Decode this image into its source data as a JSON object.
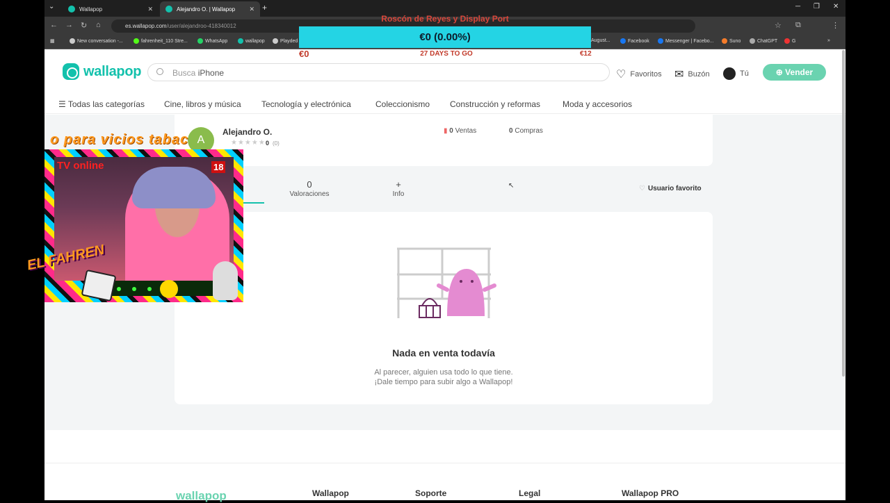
{
  "browser": {
    "tabs": [
      {
        "label": "Wallapop"
      },
      {
        "label": "Alejandro O. | Wallapop"
      }
    ],
    "url_host": "es.wallapop.com",
    "url_path": "/user/alejandroo-418340012",
    "bookmarks": [
      "New conversation -...",
      "fahrenheit_110 Stre...",
      "WhatsApp",
      "wallapop",
      "Playded",
      "August...",
      "Facebook",
      "Messenger | Facebo...",
      "Suno",
      "ChatGPT",
      "G"
    ]
  },
  "stream": {
    "title": "Roscón de Reyes y Display Port",
    "progress_label": "€0 (0.00%)",
    "progress_fraction": 0.0,
    "current": "€0",
    "days_to_go": "27 DAYS TO GO",
    "goal": "€12",
    "cam_top_text": "o para vicios tabac",
    "tv_online": "TV online",
    "age_badge": "18",
    "brand": "EL FAHREN"
  },
  "header": {
    "logo": "wallapop",
    "search_prefix": "Busca",
    "search_term": "iPhone",
    "favoritos": "Favoritos",
    "buzon": "Buzón",
    "tu": "Tú",
    "sell": "Vender"
  },
  "categories": [
    "Todas las categorías",
    "Cine, libros y música",
    "Tecnología y electrónica",
    "Coleccionismo",
    "Construcción y reformas",
    "Moda y accesorios"
  ],
  "profile": {
    "avatar_letter": "A",
    "name": "Alejandro O.",
    "rating": "0",
    "rating_count": "(0)",
    "ventas_num": "0",
    "ventas_label": "Ventas",
    "compras_num": "0",
    "compras_label": "Compras"
  },
  "tabs": {
    "valoraciones_num": "0",
    "valoraciones": "Valoraciones",
    "info_symbol": "+",
    "info": "Info",
    "usuario_favorito": "Usuario favorito"
  },
  "empty": {
    "title": "Nada en venta todavía",
    "description": "Al parecer, alguien usa todo lo que tiene. ¡Dale tiempo para subir algo a Wallapop!"
  },
  "footer": {
    "logo": "wallapop",
    "columns": [
      "Wallapop",
      "Soporte",
      "Legal",
      "Wallapop PRO"
    ]
  },
  "colors": {
    "brand": "#13c1ac",
    "sell_button": "#6ad3b0",
    "progress_bar": "#24d4e4"
  }
}
